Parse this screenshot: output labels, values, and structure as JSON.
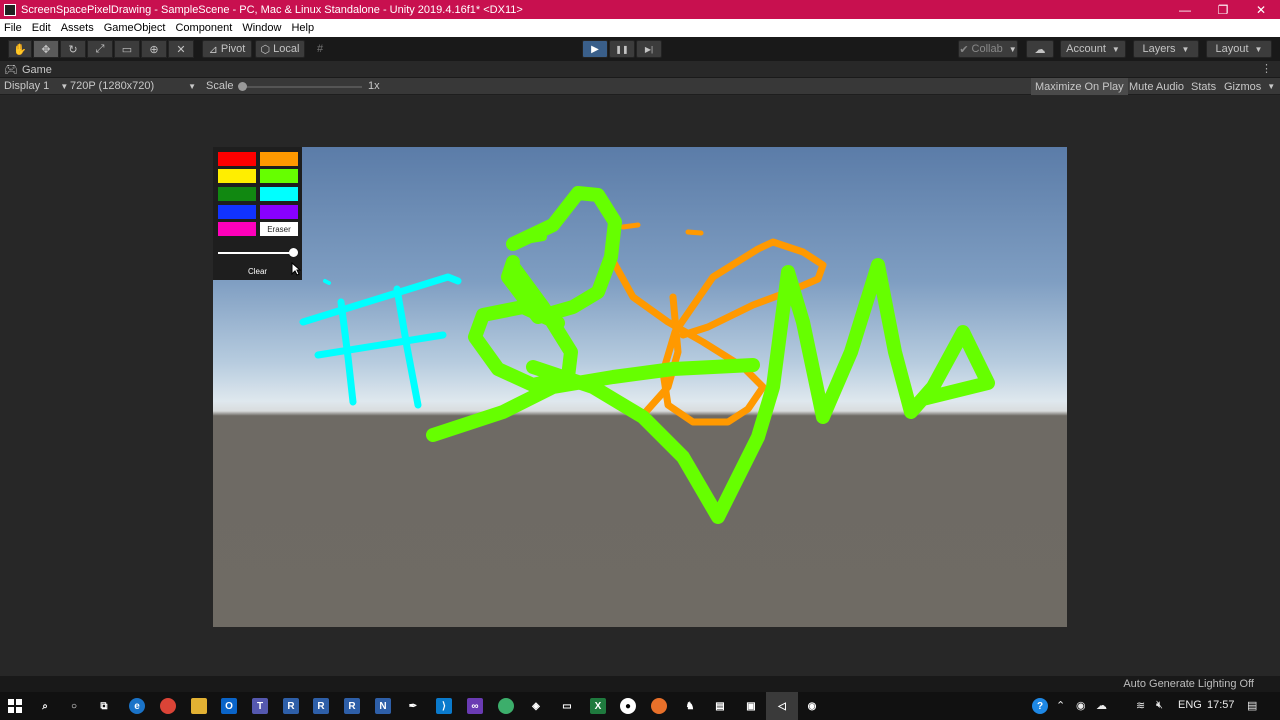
{
  "window": {
    "title": "ScreenSpacePixelDrawing - SampleScene - PC, Mac & Linux Standalone - Unity 2019.4.16f1* <DX11>",
    "minimize": "—",
    "restore": "❐",
    "close": "✕"
  },
  "menu": [
    "File",
    "Edit",
    "Assets",
    "GameObject",
    "Component",
    "Window",
    "Help"
  ],
  "toolbar": {
    "tools": [
      "hand-icon",
      "move-icon",
      "rotate-icon",
      "scale-icon",
      "rect-icon",
      "transform-icon",
      "custom-tool-icon"
    ],
    "pivot_label": "Pivot",
    "local_label": "Local",
    "play_glyph": "▶",
    "pause_glyph": "❚❚",
    "step_glyph": "▶|",
    "collab_label": "Collab",
    "account_label": "Account",
    "layers_label": "Layers",
    "layout_label": "Layout"
  },
  "game_tab": {
    "label": "Game"
  },
  "game_bar": {
    "display": "Display 1",
    "resolution": "720P (1280x720)",
    "scale_label": "Scale",
    "scale_value": "1x",
    "scale_fraction": 0,
    "maximize_on_play": "Maximize On Play",
    "mute_audio": "Mute Audio",
    "stats": "Stats",
    "gizmos": "Gizmos"
  },
  "palette": {
    "colors": [
      "#ff0000",
      "#ff9900",
      "#ffee00",
      "#66ff00",
      "#118811",
      "#00ffff",
      "#1133ff",
      "#8800ff",
      "#ff00bb"
    ],
    "eraser_label": "Eraser",
    "clear_label": "Clear",
    "brush_size_fraction": 1.0
  },
  "colors": {
    "title_bar": "#c8104f",
    "stroke_green": "#66ff00",
    "stroke_orange": "#ff9900",
    "stroke_cyan": "#00ffff"
  },
  "status": {
    "text": "Auto Generate Lighting Off"
  },
  "taskbar": {
    "tray_lang": "ENG",
    "clock": "17:57"
  }
}
